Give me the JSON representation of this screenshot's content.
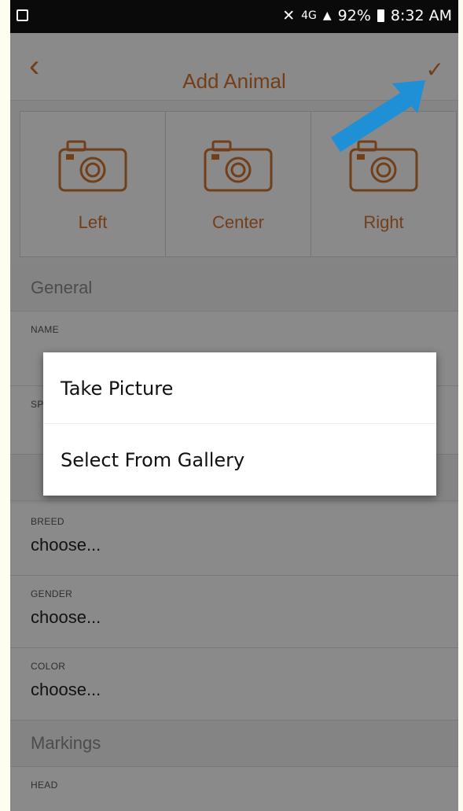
{
  "status": {
    "battery": "92%",
    "time": "8:32 AM",
    "network": "4G"
  },
  "appbar": {
    "title": "Add Animal"
  },
  "photos": [
    {
      "label": "Left"
    },
    {
      "label": "Center"
    },
    {
      "label": "Right"
    }
  ],
  "sections": {
    "general": "General",
    "markings": "Markings"
  },
  "fields": {
    "name": {
      "label": "NAME"
    },
    "species": {
      "label": "SP"
    },
    "breed": {
      "label": "BREED",
      "value": "choose..."
    },
    "gender": {
      "label": "GENDER",
      "value": "choose..."
    },
    "color": {
      "label": "COLOR",
      "value": "choose..."
    },
    "head": {
      "label": "HEAD"
    }
  },
  "dialog": {
    "take_picture": "Take Picture",
    "select_gallery": "Select From Gallery"
  },
  "colors": {
    "accent": "#d0732e",
    "arrow": "#1f8fd6"
  }
}
